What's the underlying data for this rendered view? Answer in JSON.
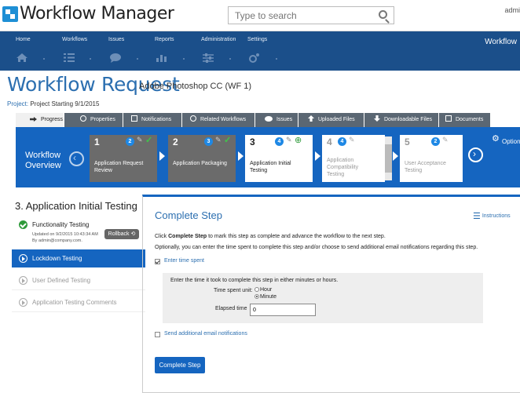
{
  "app": {
    "title": "Workflow Manager",
    "brand": "Workflow",
    "user": "admi"
  },
  "search": {
    "placeholder": "Type to search"
  },
  "nav": {
    "items": [
      "Home",
      "Workflows",
      "Issues",
      "Reports",
      "Administration",
      "Settings"
    ],
    "icons": [
      "home-icon",
      "list-icon",
      "chat-icon",
      "chart-icon",
      "sliders-icon",
      "gear-icon"
    ]
  },
  "page": {
    "title": "Workflow Request",
    "subtitle": "Adobe Photoshop CC (WF 1)",
    "project_label": "Project:",
    "project_value": "Project Starting 9/1/2015"
  },
  "tabs": [
    "Progress",
    "Properties",
    "Notifications",
    "Related Workflows",
    "Issues",
    "Uploaded Files",
    "Downloadable Files",
    "Documents"
  ],
  "overview": {
    "title_line1": "Workflow",
    "title_line2": "Overview",
    "option_label": "Option",
    "steps": [
      {
        "num": "1",
        "badge": "2",
        "label1": "Application Request",
        "label2": "Review"
      },
      {
        "num": "2",
        "badge": "3",
        "label1": "Application Packaging",
        "label2": ""
      },
      {
        "num": "3",
        "badge": "4",
        "label1": "Application Initial",
        "label2": "Testing"
      },
      {
        "num": "4",
        "badge": "4",
        "label1": "Application",
        "label2": "Compatibility",
        "label3": "Testing"
      },
      {
        "num": "5",
        "badge": "2",
        "label1": "User Acceptance",
        "label2": "Testing"
      }
    ]
  },
  "sidebar": {
    "title": "3. Application Initial Testing",
    "items": [
      {
        "label": "Functionality Testing",
        "meta1": "Updated on 9/2/2015 10:43:34 AM",
        "meta2": "By admin@company.com.",
        "button": "Rollback"
      },
      {
        "label": "Lockdown Testing"
      },
      {
        "label": "User Defined Testing"
      },
      {
        "label": "Application Testing Comments"
      }
    ]
  },
  "main": {
    "title": "Complete Step",
    "instructions": "Instructions",
    "line1_pre": "Click ",
    "line1_bold": "Complete Step",
    "line1_post": " to mark this step as complete and advance the workflow to the next step.",
    "line2": "Optionally, you can enter the time spent to complete this step and/or choose to send additional email notifications regarding this step.",
    "enter_time_label": "Enter time spent",
    "time_prompt": "Enter the time it took to complete this step in either minutes or hours.",
    "time_unit_label": "Time spent unit:",
    "unit_hour": "Hour",
    "unit_minute": "Minute",
    "elapsed_label": "Elapsed time",
    "elapsed_value": "0",
    "email_label": "Send additional email notifications",
    "complete_button": "Complete Step"
  }
}
